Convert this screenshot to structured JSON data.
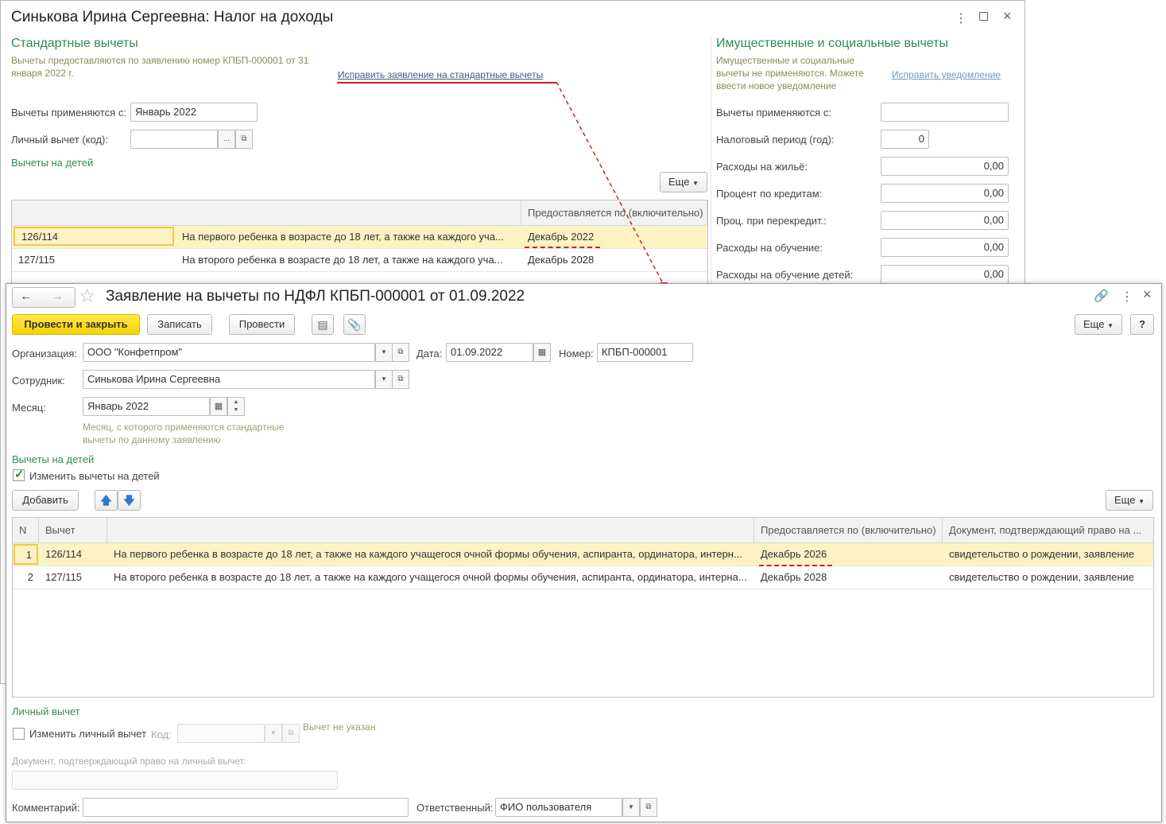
{
  "back_window": {
    "title": "Синькова Ирина Сергеевна: Налог на доходы",
    "standard_heading": "Стандартные вычеты",
    "standard_info": "Вычеты предоставляются по заявлению номер КПБП-000001 от 31 января 2022 г.",
    "fix_standard_link": "Исправить заявление на стандартные вычеты",
    "applied_from_label": "Вычеты применяются с:",
    "applied_from_value": "Январь 2022",
    "personal_code_label": "Личный вычет (код):",
    "personal_code_value": "",
    "children_heading": "Вычеты на детей",
    "more_label": "Еще",
    "table_header_provided": "Предоставляется по (включительно)",
    "rows": [
      {
        "code": "126/114",
        "desc": "На первого ребенка в возрасте до 18 лет, а также на каждого уча...",
        "until": "Декабрь 2022"
      },
      {
        "code": "127/115",
        "desc": "На второго ребенка в возрасте до 18 лет, а также на каждого уча...",
        "until": "Декабрь 2028"
      }
    ],
    "property_heading": "Имущественные и социальные вычеты",
    "property_info": "Имущественные и социальные вычеты не применяются. Можете ввести новое уведомление",
    "fix_notice_link": "Исправить уведомление",
    "property_fields": [
      {
        "label": "Вычеты применяются с:",
        "value": ""
      },
      {
        "label": "Налоговый период (год):",
        "value": "0"
      },
      {
        "label": "Расходы на жильё:",
        "value": "0,00"
      },
      {
        "label": "Процент по кредитам:",
        "value": "0,00"
      },
      {
        "label": "Проц. при перекредит.:",
        "value": "0,00"
      },
      {
        "label": "Расходы на обучение:",
        "value": "0,00"
      },
      {
        "label": "Расходы на обучение детей:",
        "value": "0,00"
      }
    ]
  },
  "front_window": {
    "title": "Заявление на вычеты по НДФЛ КПБП-000001 от 01.09.2022",
    "toolbar": {
      "post_close": "Провести и закрыть",
      "save": "Записать",
      "post": "Провести",
      "more": "Еще",
      "help": "?"
    },
    "org_label": "Организация:",
    "org_value": "ООО \"Конфетпром\"",
    "date_label": "Дата:",
    "date_value": "01.09.2022",
    "number_label": "Номер:",
    "number_value": "КПБП-000001",
    "employee_label": "Сотрудник:",
    "employee_value": "Синькова Ирина Сергеевна",
    "month_label": "Месяц:",
    "month_value": "Январь 2022",
    "month_hint": "Месяц, с которого применяются стандартные вычеты по данному заявлению",
    "children_heading": "Вычеты на детей",
    "change_children_label": "Изменить вычеты на детей",
    "change_children_checked": true,
    "add_button": "Добавить",
    "more_label": "Еще",
    "table": {
      "headers": [
        "N",
        "Вычет",
        "",
        "Предоставляется по (включительно)",
        "Документ, подтверждающий право на ..."
      ],
      "rows": [
        {
          "n": "1",
          "code": "126/114",
          "desc": "На первого ребенка в возрасте до 18 лет, а также на каждого учащегося очной формы обучения, аспиранта, ординатора, интерн...",
          "until": "Декабрь 2026",
          "doc": "свидетельство о рождении, заявление"
        },
        {
          "n": "2",
          "code": "127/115",
          "desc": "На второго ребенка в возрасте до 18 лет, а также на каждого учащегося очной формы обучения, аспиранта, ординатора, интерна...",
          "until": "Декабрь 2028",
          "doc": "свидетельство о рождении, заявление"
        }
      ]
    },
    "personal_heading": "Личный вычет",
    "change_personal_label": "Изменить личный вычет",
    "code_label": "Код:",
    "not_specified": "Вычет не указан",
    "personal_doc_label": "Документ, подтверждающий право на личный вычет:",
    "comment_label": "Комментарий:",
    "responsible_label": "Ответственный:",
    "responsible_value": "ФИО пользователя"
  },
  "colors": {
    "accent_green": "#2e8b57",
    "highlight_row": "#fdf2c4",
    "primary_button": "#f5d200",
    "annotation_red": "#d02020"
  }
}
